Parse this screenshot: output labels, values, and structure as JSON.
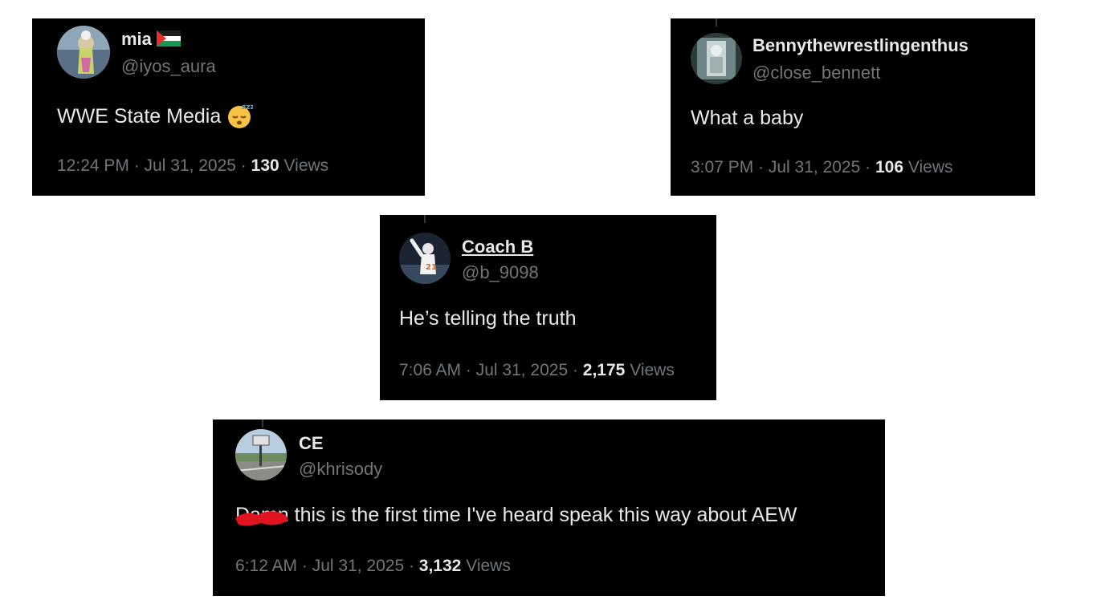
{
  "tweets": [
    {
      "name": "mia",
      "flag_icon": "palestine-flag-icon",
      "handle": "@iyos_aura",
      "text": "WWE State Media",
      "emoji_icon": "sleeping-face-icon",
      "time": "12:24 PM · Jul 31, 2025 · ",
      "views_count": "130",
      "views_label": " Views"
    },
    {
      "name": "Bennythewrestlingenthus",
      "handle": "@close_bennett",
      "text": "What a baby",
      "time": "3:07 PM · Jul 31, 2025 · ",
      "views_count": "106",
      "views_label": " Views"
    },
    {
      "name": "Coach B",
      "handle": "@b_9098",
      "text": "He’s telling the truth",
      "time": "7:06 AM · Jul 31, 2025 · ",
      "views_count": "2,175",
      "views_label": " Views"
    },
    {
      "name": "CE",
      "handle": "@khrisody",
      "text_redacted": "Damn",
      "text": " this is the first time I've heard speak this way about AEW",
      "time": "6:12 AM · Jul 31, 2025 · ",
      "views_count": "3,132",
      "views_label": " Views"
    }
  ],
  "colors": {
    "card_bg": "#000000",
    "primary_text": "#e7e9ea",
    "secondary_text": "#71767b",
    "redaction": "#e0141e"
  }
}
